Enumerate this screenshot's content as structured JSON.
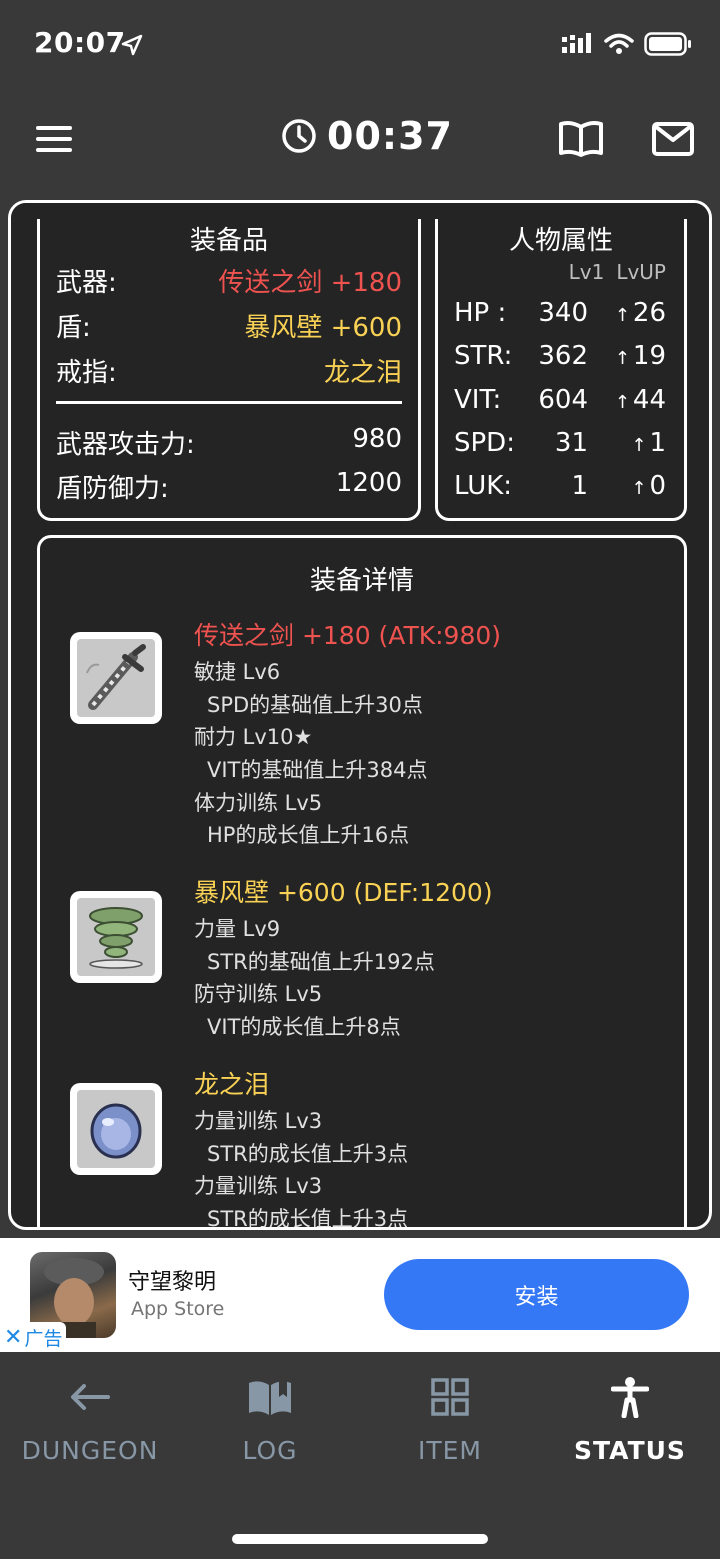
{
  "status_bar": {
    "time": "20:07"
  },
  "header": {
    "timer": "00:37"
  },
  "equipment": {
    "title": "装备品",
    "weapon_label": "武器:",
    "weapon_value": "传送之剑 +180",
    "shield_label": "盾:",
    "shield_value": "暴风壁 +600",
    "ring_label": "戒指:",
    "ring_value": "龙之泪",
    "atk_label": "武器攻击力:",
    "atk_value": "980",
    "def_label": "盾防御力:",
    "def_value": "1200"
  },
  "attributes": {
    "title": "人物属性",
    "col_lv1": "Lv1",
    "col_lvup": "LvUP",
    "rows": [
      {
        "name": "HP :",
        "value": "340",
        "up": "26"
      },
      {
        "name": "STR:",
        "value": "362",
        "up": "19"
      },
      {
        "name": "VIT:",
        "value": "604",
        "up": "44"
      },
      {
        "name": "SPD:",
        "value": "31",
        "up": "1"
      },
      {
        "name": "LUK:",
        "value": "1",
        "up": "0"
      }
    ]
  },
  "details": {
    "title": "装备详情",
    "items": [
      {
        "name": "传送之剑 +180 (ATK:980)",
        "color": "#ef5350",
        "icon": "sword-icon",
        "lines": [
          "敏捷 Lv6",
          "SPD的基础值上升30点",
          "耐力 Lv10★",
          "VIT的基础值上升384点",
          "体力训练 Lv5",
          "HP的成长值上升16点"
        ]
      },
      {
        "name": "暴风壁 +600 (DEF:1200)",
        "color": "#f9d255",
        "icon": "tornado-shield-icon",
        "lines": [
          "力量 Lv9",
          "STR的基础值上升192点",
          "防守训练 Lv5",
          "VIT的成长值上升8点"
        ]
      },
      {
        "name": "龙之泪",
        "color": "#f9d255",
        "icon": "dragon-tear-gem-icon",
        "lines": [
          "力量训练 Lv3",
          "STR的成长值上升3点",
          "力量训练 Lv3",
          "STR的成长值上升3点"
        ]
      }
    ]
  },
  "ad": {
    "title": "守望黎明",
    "subtitle": "App Store",
    "button": "安装",
    "tag": "广告"
  },
  "tabs": [
    {
      "label": "DUNGEON",
      "icon": "arrow-left-icon",
      "active": false
    },
    {
      "label": "LOG",
      "icon": "book-icon",
      "active": false
    },
    {
      "label": "ITEM",
      "icon": "grid-icon",
      "active": false
    },
    {
      "label": "STATUS",
      "icon": "person-icon",
      "active": true
    }
  ]
}
